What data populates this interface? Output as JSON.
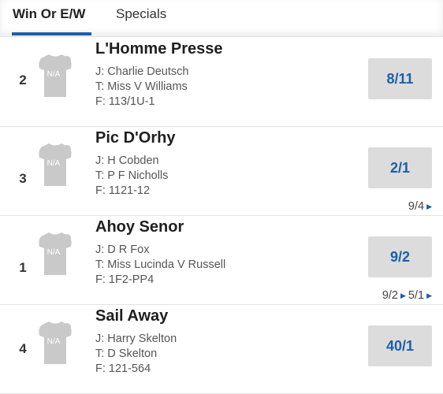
{
  "tabs": [
    {
      "label": "Win Or E/W",
      "active": true
    },
    {
      "label": "Specials",
      "active": false
    }
  ],
  "colors": {
    "accent": "#1d5fa8",
    "odds_bg": "#dcdcdc",
    "silk": "#c9c9c9"
  },
  "runners": [
    {
      "number": "2",
      "silk_text": "N/A",
      "name": "L'Homme Presse",
      "jockey": "J: Charlie Deutsch",
      "trainer": "T: Miss V Williams",
      "form": "F: 113/1U-1",
      "odds": "8/11",
      "history": []
    },
    {
      "number": "3",
      "silk_text": "N/A",
      "name": "Pic D'Orhy",
      "jockey": "J: H Cobden",
      "trainer": "T: P F Nicholls",
      "form": "F: 1121-12",
      "odds": "2/1",
      "history": [
        "9/4"
      ]
    },
    {
      "number": "1",
      "silk_text": "N/A",
      "name": "Ahoy Senor",
      "jockey": "J: D R Fox",
      "trainer": "T: Miss Lucinda V Russell",
      "form": "F: 1F2-PP4",
      "odds": "9/2",
      "history": [
        "9/2",
        "5/1"
      ]
    },
    {
      "number": "4",
      "silk_text": "N/A",
      "name": "Sail Away",
      "jockey": "J: Harry Skelton",
      "trainer": "T: D Skelton",
      "form": "F: 121-564",
      "odds": "40/1",
      "history": []
    }
  ]
}
